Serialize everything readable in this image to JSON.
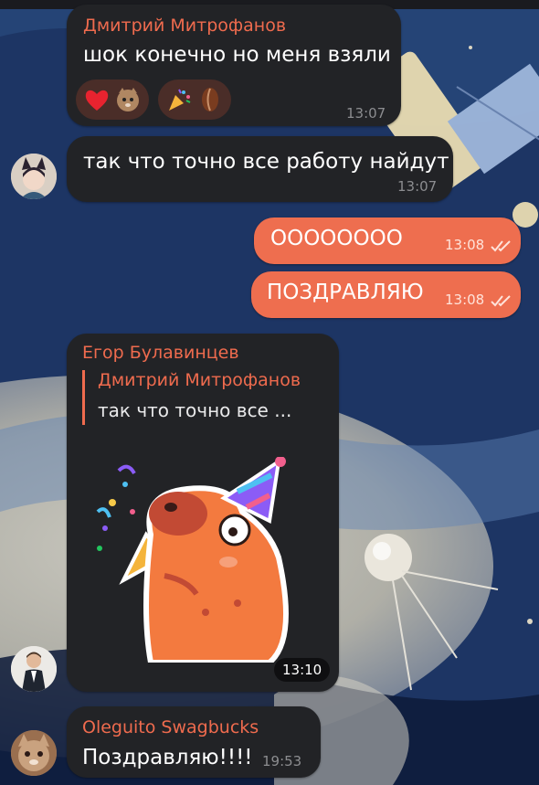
{
  "messages": [
    {
      "sender": "Дмитрий Митрофанов",
      "text": "шок конечно но меня взяли",
      "time": "13:07",
      "reactions": [
        {
          "icons": [
            "heart-icon",
            "cat-face-icon"
          ]
        },
        {
          "icons": [
            "party-popper-icon",
            "bean-icon"
          ]
        }
      ]
    },
    {
      "text": "так что точно все работу найдут",
      "time": "13:07",
      "avatar": "fox-girl-avatar"
    },
    {
      "text": "ОООООООО",
      "time": "13:08",
      "outgoing": true
    },
    {
      "text": "ПОЗДРАВЛЯЮ",
      "time": "13:08",
      "outgoing": true
    },
    {
      "sender": "Егор Булавинцев",
      "reply_to": {
        "sender": "Дмитрий Митрофанов",
        "text": "так что точно все ..."
      },
      "sticker": "capybara-party-sticker",
      "time": "13:10",
      "avatar": "man-suit-avatar"
    },
    {
      "sender": "Oleguito Swagbucks",
      "text": "Поздравляю!!!!",
      "time": "19:53",
      "avatar": "cat-avatar"
    }
  ],
  "colors": {
    "accent": "#ef6b4e",
    "incoming_bubble": "#222326",
    "outgoing_bubble": "#ee6e4f"
  }
}
